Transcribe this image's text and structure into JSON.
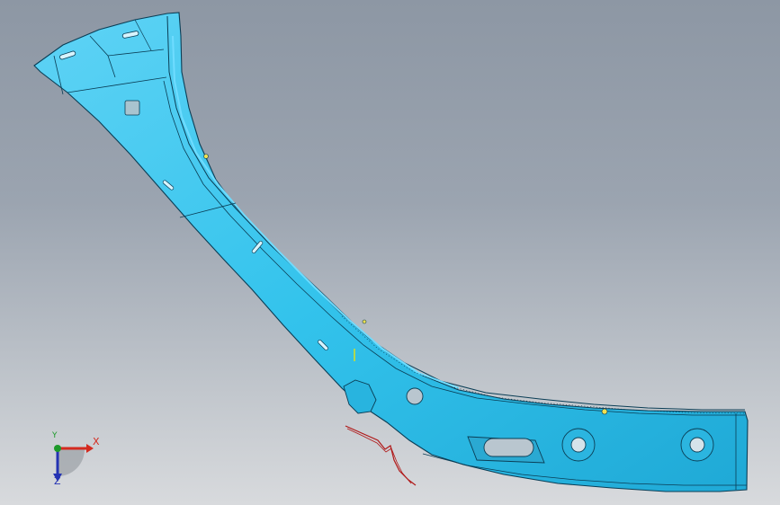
{
  "viewport": {
    "background_top": "#8d97a4",
    "background_bottom": "#d8dadd"
  },
  "part": {
    "fill_color": "#33c3ec",
    "edge_color": "#0a3d55",
    "highlight_color": "#6fdcff"
  },
  "section_curve": {
    "color": "#b01818"
  },
  "triad": {
    "x_label": "X",
    "y_label": "Y",
    "z_label": "Z",
    "x_color": "#d42a1f",
    "y_color": "#1d9a2a",
    "z_color": "#2433b3"
  }
}
